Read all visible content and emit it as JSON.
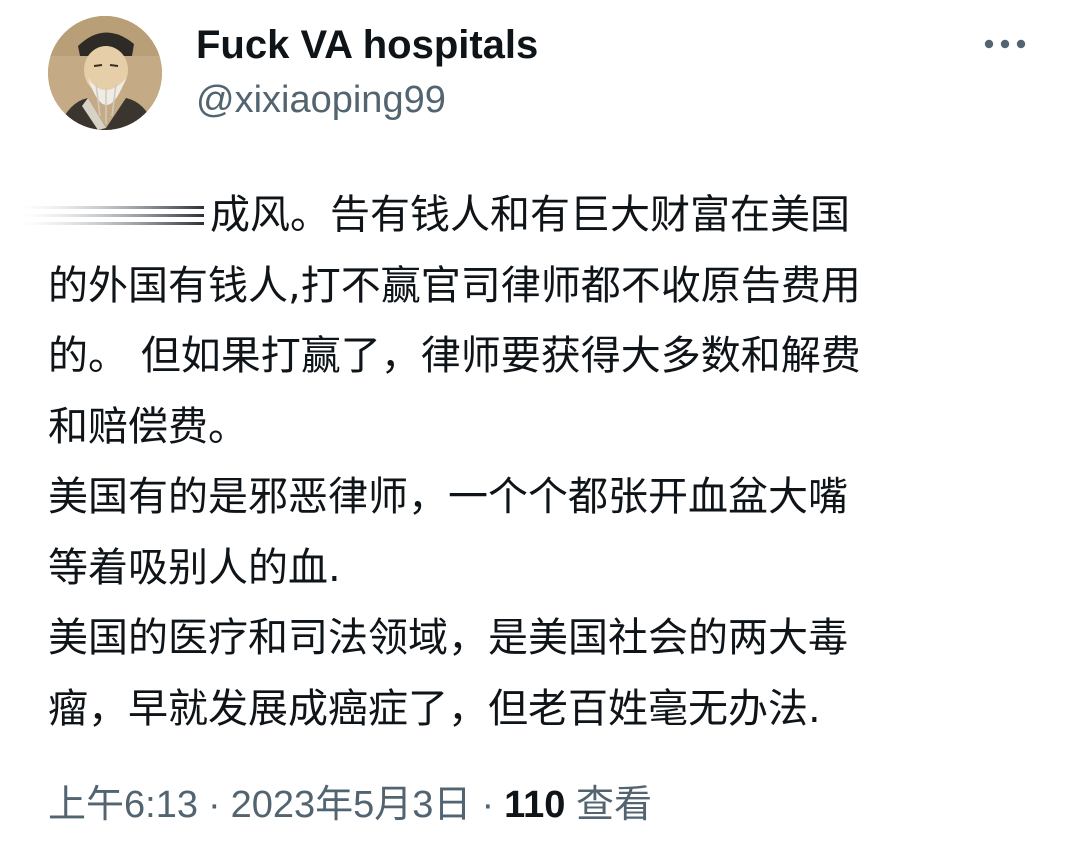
{
  "tweet": {
    "author": {
      "display_name": "Fuck VA hospitals",
      "handle": "@xixiaoping99",
      "avatar_icon": "avatar-portrait-icon"
    },
    "more_icon": "more-horizontal-icon",
    "text_lines": [
      "成风。告有钱人和有巨大财富在美国",
      "的外国有钱人,打不赢官司律师都不收原告费用",
      "的。 但如果打赢了，律师要获得大多数和解费",
      "和赔偿费。",
      "美国有的是邪恶律师，一个个都张开血盆大嘴",
      "等着吸别人的血.",
      "美国的医疗和司法领域，是美国社会的两大毒",
      "瘤，早就发展成癌症了，但老百姓毫无办法."
    ],
    "timestamp": {
      "time": "上午6:13",
      "separator": "·",
      "date": "2023年5月3日",
      "views_count": "110",
      "views_label": "查看"
    }
  },
  "colors": {
    "text_primary": "#0f1419",
    "text_secondary": "#536471",
    "background": "#ffffff"
  }
}
